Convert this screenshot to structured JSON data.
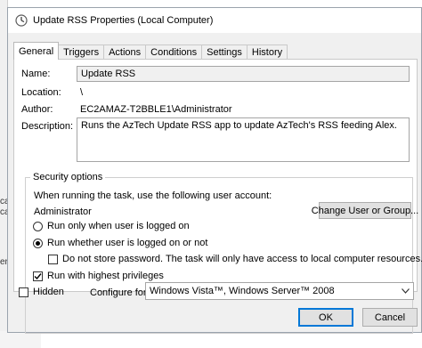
{
  "window": {
    "title": "Update RSS Properties (Local Computer)",
    "icon": "clock-icon"
  },
  "tabs": [
    {
      "label": "General",
      "active": true
    },
    {
      "label": "Triggers",
      "active": false
    },
    {
      "label": "Actions",
      "active": false
    },
    {
      "label": "Conditions",
      "active": false
    },
    {
      "label": "Settings",
      "active": false
    },
    {
      "label": "History",
      "active": false
    }
  ],
  "general": {
    "name_label": "Name:",
    "name_value": "Update RSS",
    "location_label": "Location:",
    "location_value": "\\",
    "author_label": "Author:",
    "author_value": "EC2AMAZ-T2BBLE1\\Administrator",
    "description_label": "Description:",
    "description_value": "Runs the AzTech Update RSS app to update AzTech's RSS feeding Alex."
  },
  "security": {
    "legend": "Security options",
    "account_prompt": "When running the task, use the following user account:",
    "account_value": "Administrator",
    "change_user_button": "Change User or Group...",
    "radio_logged_on": "Run only when user is logged on",
    "radio_logged_on_selected": false,
    "radio_whether": "Run whether user is logged on or not",
    "radio_whether_selected": true,
    "no_store_password": "Do not store password.  The task will only have access to local computer resources.",
    "no_store_password_checked": false,
    "highest_privileges": "Run with highest privileges",
    "highest_privileges_checked": true
  },
  "footer": {
    "hidden_label": "Hidden",
    "hidden_checked": false,
    "configure_label": "Configure for:",
    "configure_value": "Windows Vista™, Windows Server™ 2008"
  },
  "buttons": {
    "ok": "OK",
    "cancel": "Cancel"
  },
  "left_strip_fragments": [
    "ca",
    "ca",
    "er"
  ],
  "colors": {
    "window_bg": "#f0f0f0",
    "panel_bg": "#ffffff",
    "default_button_border": "#0078d7"
  }
}
